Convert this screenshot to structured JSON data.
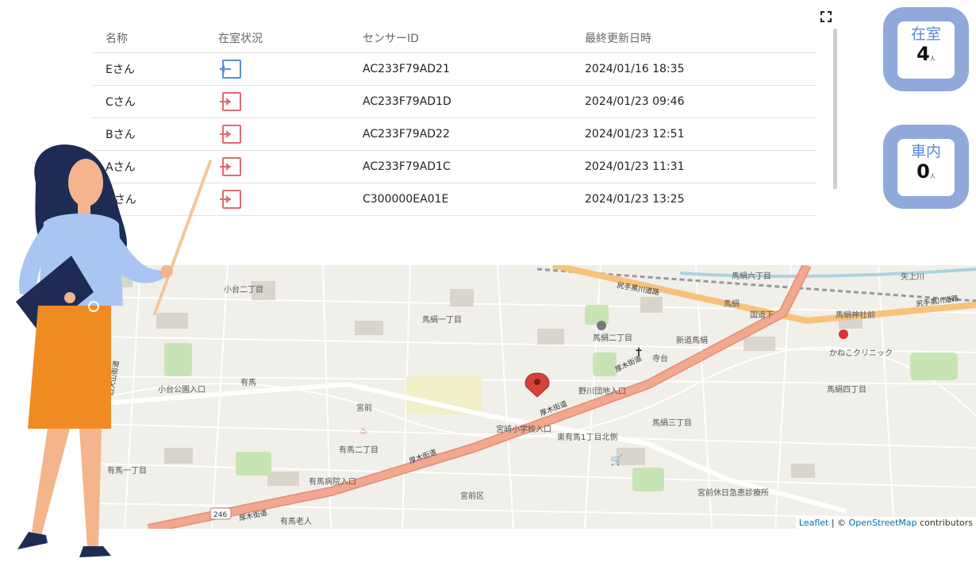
{
  "table": {
    "headers": [
      "名称",
      "在室状況",
      "センサーID",
      "最終更新日時"
    ],
    "rows": [
      {
        "name": "Eさん",
        "status": "in",
        "sensor_id": "AC233F79AD21",
        "updated": "2024/01/16 18:35"
      },
      {
        "name": "Cさん",
        "status": "out",
        "sensor_id": "AC233F79AD1D",
        "updated": "2024/01/23 09:46"
      },
      {
        "name": "Bさん",
        "status": "out",
        "sensor_id": "AC233F79AD22",
        "updated": "2024/01/23 12:51"
      },
      {
        "name": "Aさん",
        "status": "out",
        "sensor_id": "AC233F79AD1C",
        "updated": "2024/01/23 11:31"
      },
      {
        "name": "Dさん",
        "status": "out",
        "sensor_id": "C300000EA01E",
        "updated": "2024/01/23 13:25"
      }
    ],
    "status_colors": {
      "in": "#5b8fd6",
      "out": "#e06a78"
    }
  },
  "counters": {
    "in_room": {
      "label": "在室",
      "value": "4",
      "unit": "人"
    },
    "in_car": {
      "label": "車内",
      "value": "0",
      "unit": "人"
    }
  },
  "map": {
    "labels": {
      "l1": "小台二丁目",
      "l2": "馬絹一丁目",
      "l3": "馬絹二丁目",
      "l4": "馬絹六丁目",
      "l5": "馬絹四丁目",
      "l6": "馬絹三丁目",
      "l7": "有馬二丁目",
      "l8": "有馬一丁目",
      "l9": "宮前区",
      "l10": "宮前",
      "l11": "有馬",
      "l12": "小台公園入口",
      "l13": "宮崎小学校入口",
      "l14": "野川団地入口",
      "l15": "東有馬1丁目北側",
      "l16": "有馬病院入口",
      "l17": "かねこクリニック",
      "l18": "馬絹神社前",
      "l19": "国道下",
      "l20": "矢上川",
      "l21": "宮前休日急患診療所",
      "l22": "有馬老人",
      "l23": "新道馬絹",
      "l24": "寺台",
      "l25": "馬絹"
    },
    "roads": {
      "atsugi": "厚木街道",
      "shirite": "尻手黒川道路",
      "r246": "246",
      "oyama": "旧大山街道"
    },
    "attribution": {
      "leaflet": "Leaflet",
      "sep": " | © ",
      "osm": "OpenStreetMap",
      "rest": " contributors"
    },
    "colors": {
      "major_road": "#f3a78f",
      "secondary_road": "#f7c27a",
      "park": "#c7e5b4",
      "marker": "#d8413a"
    }
  }
}
